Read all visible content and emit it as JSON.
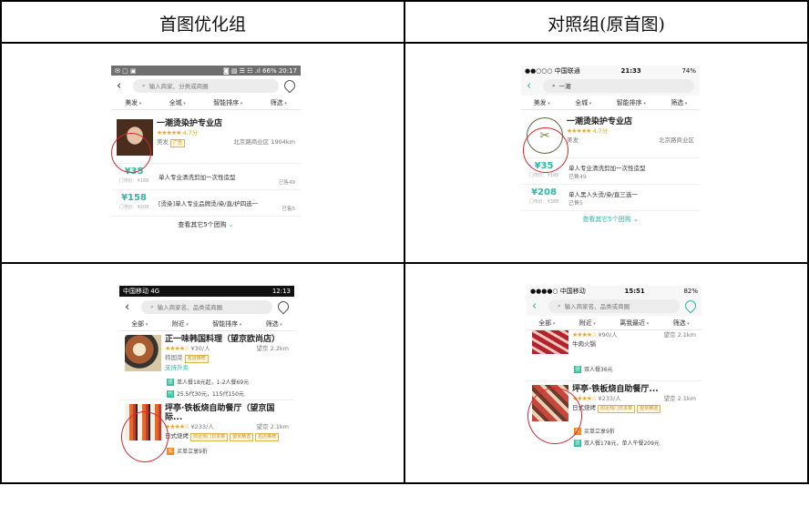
{
  "headers": {
    "optimized": "首图优化组",
    "control": "对照组(原首图)"
  },
  "p1": {
    "status_right": "◙ ▧ ☰ ☷ .ıl 66% 20:17",
    "search_placeholder": "输入商家、分类或商圈",
    "filters": [
      "美发",
      "全城",
      "智能排序",
      "筛选"
    ],
    "shop_name": "一潮烫染护专业店",
    "rating": "4.7分",
    "category": "美发",
    "tag": "广告",
    "area": "北京路商业区",
    "distance": "1904km",
    "deals": [
      {
        "price": "¥35",
        "orig": "门市价：¥188",
        "title": "单人专业清洗剪加一次性造型",
        "sold": "已售49"
      },
      {
        "price": "¥158",
        "orig": "门市价：¥208",
        "title": "[烫染]单人专业品牌烫/染/直/护四选一",
        "sold": "已售5"
      }
    ],
    "more": "查看其它5个团购"
  },
  "p2": {
    "status_left": "●●○○○ 中国联通",
    "status_time": "21:33",
    "status_right": "74%",
    "search_text": "一潮",
    "filters": [
      "美发",
      "全城",
      "智能排序",
      "筛选"
    ],
    "shop_name": "一潮烫染护专业店",
    "rating": "4.7分",
    "category": "美发",
    "area": "北京路商业区",
    "deals": [
      {
        "price": "¥35",
        "orig": "门市价：¥188",
        "title": "单人专业清洗剪加一次性造型",
        "sold": "已售49"
      },
      {
        "price": "¥208",
        "orig": "门市价：¥388",
        "title": "单人黑人头烫/染/直三选一",
        "sold": "已售5"
      }
    ],
    "more": "查看其它5个团购"
  },
  "p3": {
    "status_left": "中国移动 4G",
    "status_time": "12:13",
    "search_placeholder": "输入商家名、品类或商圈",
    "filters": [
      "全部",
      "附近",
      "智能排序",
      "筛选"
    ],
    "shop1": {
      "name": "正一味韩国料理（望京欧尚店）",
      "price": "¥30/人",
      "area": "望京",
      "distance": "2.2km",
      "category": "韩国菜",
      "tag": "名店推荐",
      "extra": "支持外卖",
      "promos": [
        "单人餐18元起，1-2人餐69元",
        "25.5代30元，115代150元"
      ]
    },
    "shop2": {
      "name": "坪亭·铁板烧自助餐厅（望京国际...",
      "price": "¥233/人",
      "area": "望京",
      "distance": "2.1km",
      "category": "日式烧烤",
      "tags": [
        "附近热门日本菜",
        "望京精选",
        "名店推荐"
      ],
      "promo": "买单立享9折"
    }
  },
  "p4": {
    "status_left": "●●●●○ 中国移动",
    "status_time": "15:51",
    "status_right": "82%",
    "search_placeholder": "输入商家名、品类或商圈",
    "filters": [
      "全部",
      "附近",
      "离我最近",
      "筛选"
    ],
    "shop1": {
      "price": "¥90/人",
      "area": "望京",
      "distance": "2.1km",
      "category": "牛肉火锅",
      "promo": "双人餐36元"
    },
    "shop2": {
      "name": "坪亭·铁板烧自助餐厅...",
      "price": "¥233/人",
      "area": "望京",
      "distance": "2.1km",
      "category": "日式烧烤",
      "tags": [
        "附近热门日本菜",
        "望京精选"
      ],
      "promos": [
        "买单立享9折",
        "双人餐178元，单人午餐209元"
      ]
    }
  }
}
